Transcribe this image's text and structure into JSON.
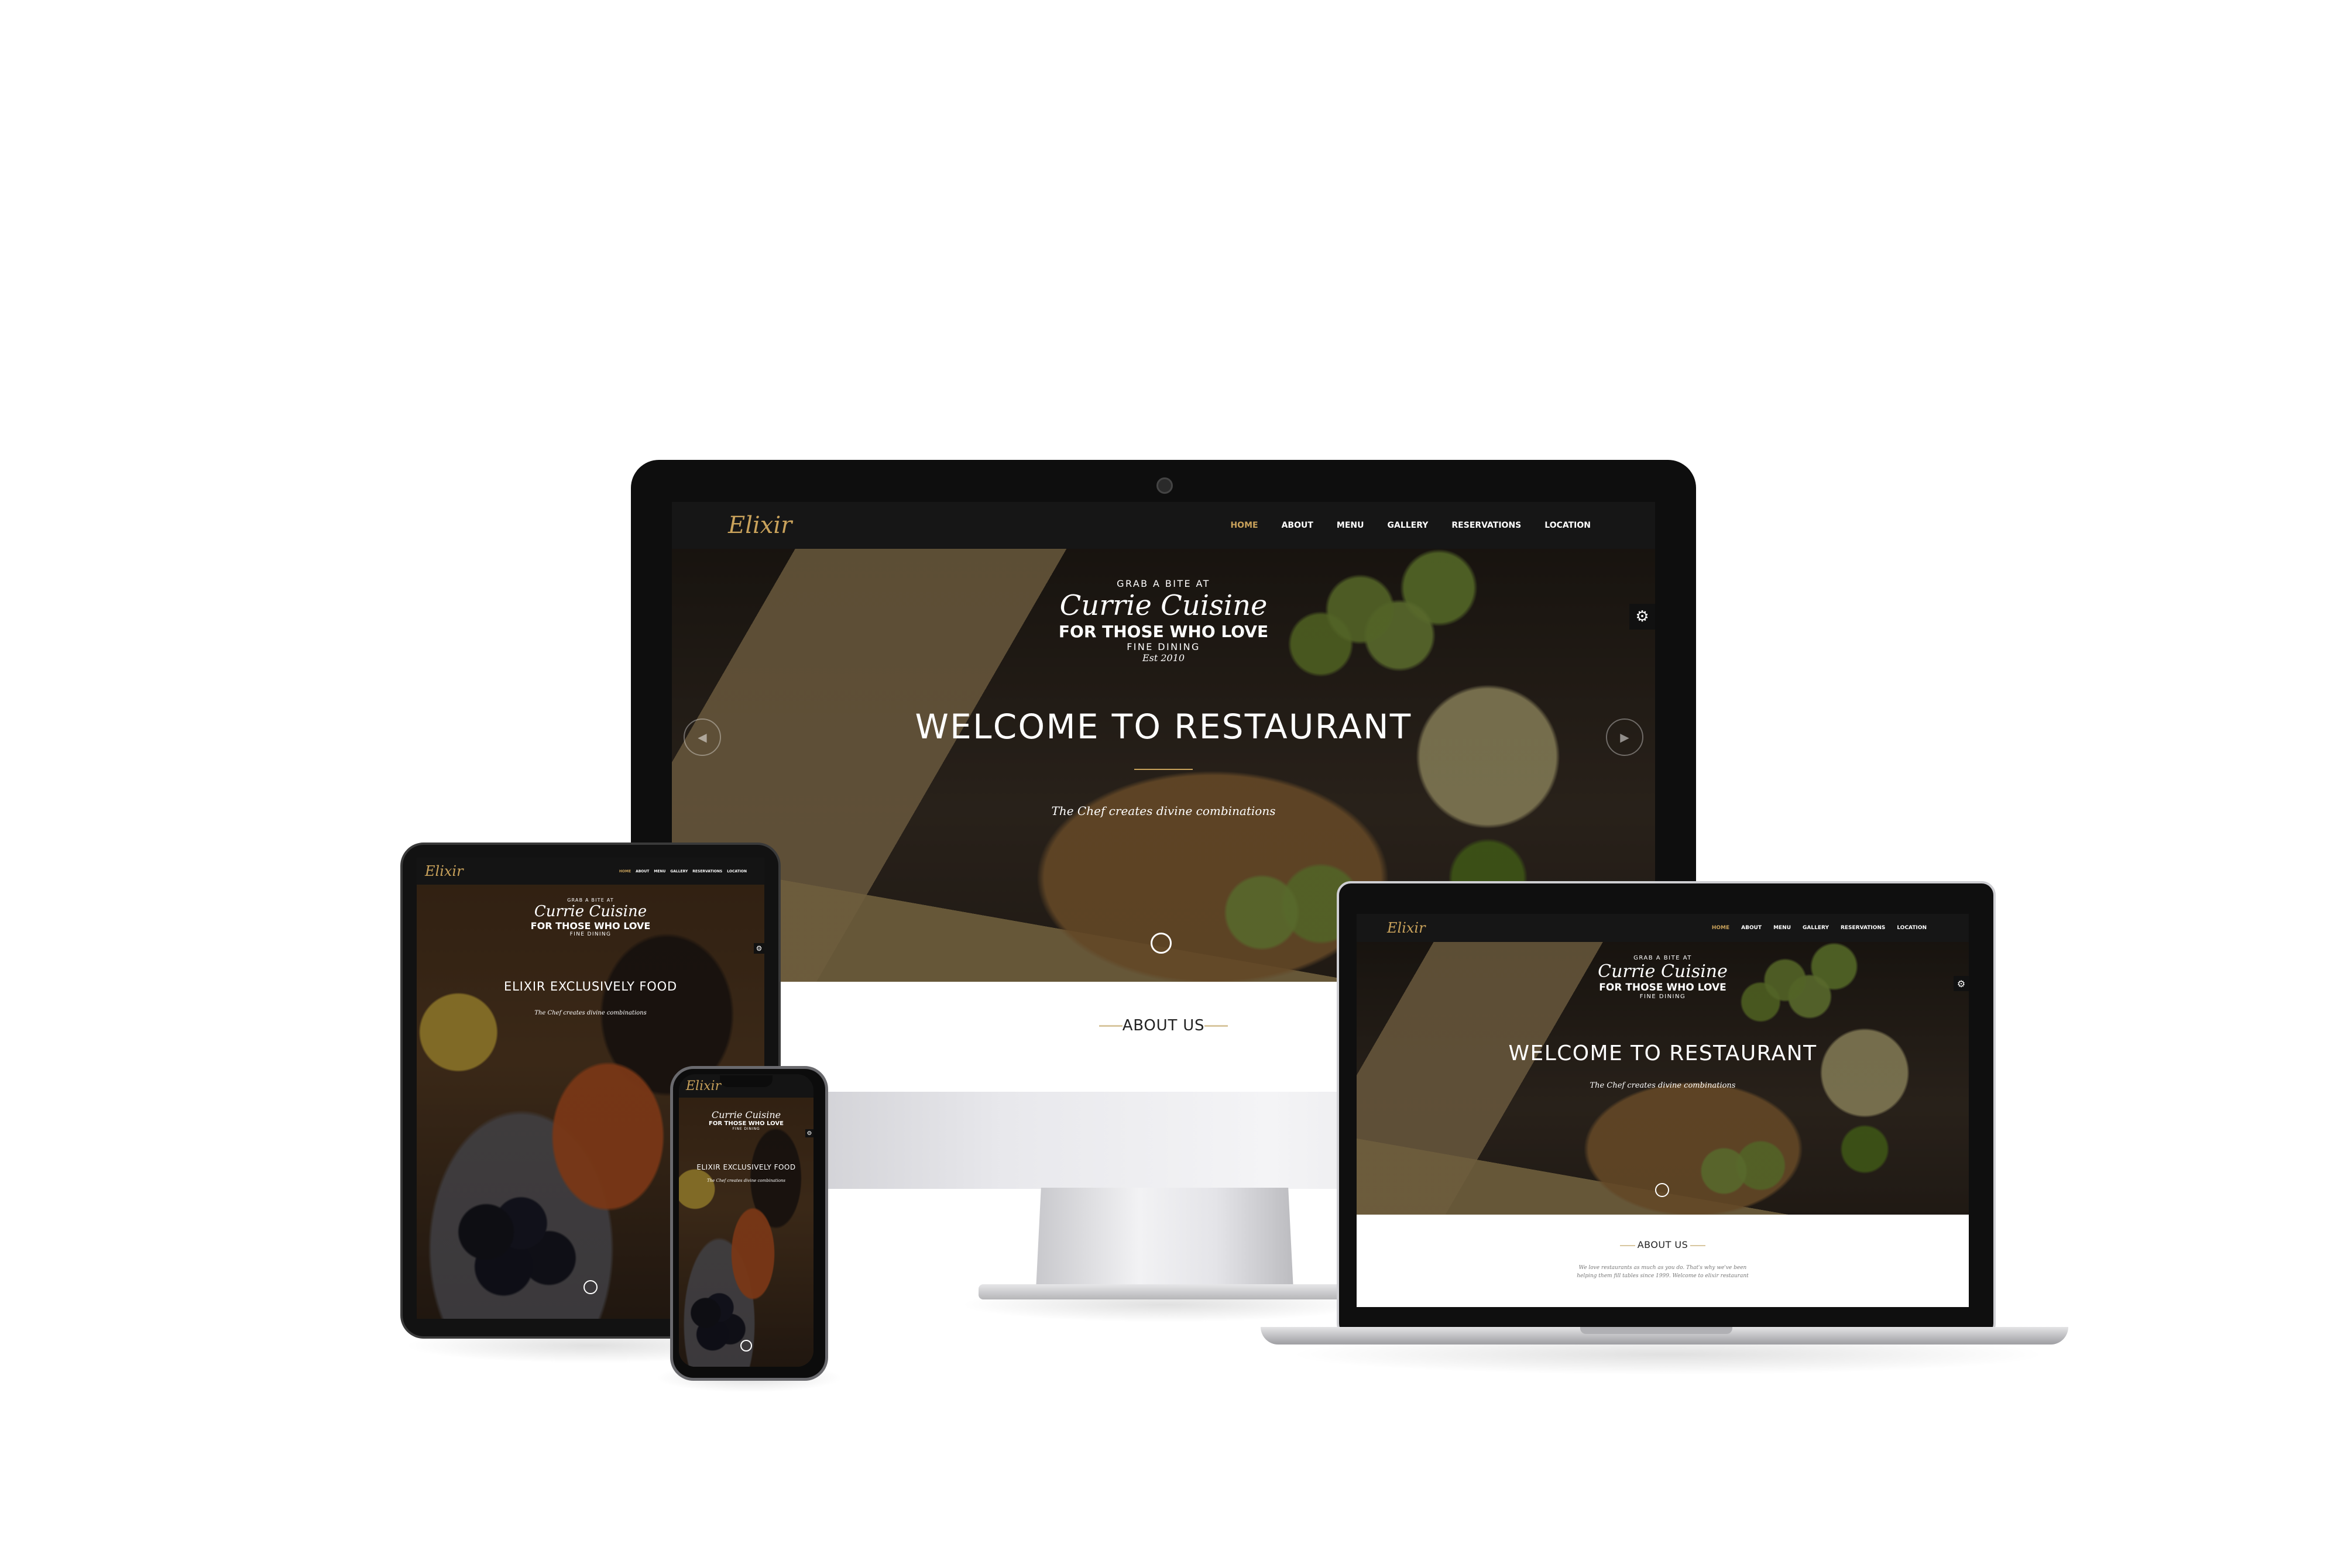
{
  "site": {
    "logo": "Elixir",
    "nav": [
      "HOME",
      "ABOUT",
      "MENU",
      "GALLERY",
      "RESERVATIONS",
      "LOCATION"
    ],
    "badge": {
      "top": "GRAB A BITE AT",
      "script": "Currie Cuisine",
      "main": "FOR THOSE WHO LOVE",
      "bottom": "FINE DINING",
      "est": "Est 2010"
    },
    "hero_title": "WELCOME TO RESTAURANT",
    "hero_subtitle": "The Chef creates divine combinations",
    "about_title": "ABOUT US",
    "about_text": "We love restaurants as much as you do. That's why we've been helping them fill tables since 1999. Welcome to elixir restaurant",
    "alt_hero_title": "ELIXIR EXCLUSIVELY FOOD",
    "alt_hero_subtitle": "The Chef creates divine combinations"
  },
  "icons": {
    "gear": "⚙",
    "prev": "◀",
    "next": "▶",
    "ornament": "⟡"
  },
  "colors": {
    "accent": "#c9a25b",
    "nav_bg": "#161616",
    "about_bg": "#ffffff"
  }
}
